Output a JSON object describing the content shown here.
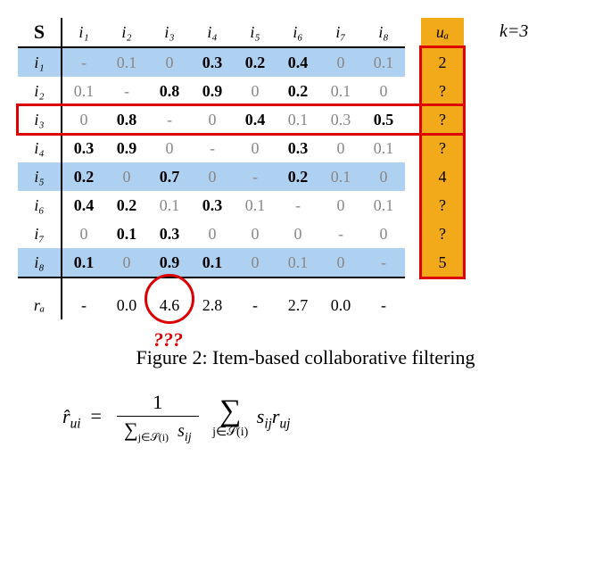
{
  "parameter_k": "k=3",
  "matrix_label": "S",
  "col_headers": [
    "i₁",
    "i₂",
    "i₃",
    "i₄",
    "i₅",
    "i₆",
    "i₇",
    "i₈"
  ],
  "row_headers": [
    "i₁",
    "i₂",
    "i₃",
    "i₄",
    "i₅",
    "i₆",
    "i₇",
    "i₈"
  ],
  "ua_header": "uₐ",
  "ra_header": "rₐ",
  "similarity": [
    [
      "-",
      "0.1",
      "0",
      "0.3",
      "0.2",
      "0.4",
      "0",
      "0.1"
    ],
    [
      "0.1",
      "-",
      "0.8",
      "0.9",
      "0",
      "0.2",
      "0.1",
      "0"
    ],
    [
      "0",
      "0.8",
      "-",
      "0",
      "0.4",
      "0.1",
      "0.3",
      "0.5"
    ],
    [
      "0.3",
      "0.9",
      "0",
      "-",
      "0",
      "0.3",
      "0",
      "0.1"
    ],
    [
      "0.2",
      "0",
      "0.7",
      "0",
      "-",
      "0.2",
      "0.1",
      "0"
    ],
    [
      "0.4",
      "0.2",
      "0.1",
      "0.3",
      "0.1",
      "-",
      "0",
      "0.1"
    ],
    [
      "0",
      "0.1",
      "0.3",
      "0",
      "0",
      "0",
      "-",
      "0"
    ],
    [
      "0.1",
      "0",
      "0.9",
      "0.1",
      "0",
      "0.1",
      "0",
      "-"
    ]
  ],
  "bold_mask": [
    [
      0,
      0,
      0,
      1,
      1,
      1,
      0,
      0
    ],
    [
      0,
      0,
      1,
      1,
      0,
      1,
      0,
      0
    ],
    [
      0,
      1,
      0,
      0,
      1,
      0,
      0,
      1
    ],
    [
      1,
      1,
      0,
      0,
      0,
      1,
      0,
      0
    ],
    [
      1,
      0,
      1,
      0,
      0,
      1,
      0,
      0
    ],
    [
      1,
      1,
      0,
      1,
      0,
      0,
      0,
      0
    ],
    [
      0,
      1,
      1,
      0,
      0,
      0,
      0,
      0
    ],
    [
      1,
      0,
      1,
      1,
      0,
      0,
      0,
      0
    ]
  ],
  "row_blue_mask": [
    1,
    0,
    0,
    0,
    1,
    0,
    0,
    1
  ],
  "ua": [
    "2",
    "?",
    "?",
    "?",
    "4",
    "?",
    "?",
    "5"
  ],
  "ra": [
    "-",
    "0.0",
    "4.6",
    "2.8",
    "-",
    "2.7",
    "0.0",
    "-"
  ],
  "circled_index": 2,
  "question_marks": "???",
  "caption": "Figure 2: Item-based collaborative filtering",
  "formula": {
    "lhs": "r̂",
    "lhs_sub": "ui",
    "denom_sum_sub": "j∈𝒮(i)",
    "denom_term": "s",
    "denom_term_sub": "ij",
    "outer_sum_sub": "j∈𝒮(i)",
    "rhs_term1": "s",
    "rhs_term1_sub": "ij",
    "rhs_term2": "r",
    "rhs_term2_sub": "uj"
  },
  "chart_data": {
    "type": "table",
    "title": "Item-item similarity matrix with user ratings",
    "items": [
      "i1",
      "i2",
      "i3",
      "i4",
      "i5",
      "i6",
      "i7",
      "i8"
    ],
    "S": [
      [
        null,
        0.1,
        0,
        0.3,
        0.2,
        0.4,
        0,
        0.1
      ],
      [
        0.1,
        null,
        0.8,
        0.9,
        0,
        0.2,
        0.1,
        0
      ],
      [
        0,
        0.8,
        null,
        0,
        0.4,
        0.1,
        0.3,
        0.5
      ],
      [
        0.3,
        0.9,
        0,
        null,
        0,
        0.3,
        0,
        0.1
      ],
      [
        0.2,
        0,
        0.7,
        0,
        null,
        0.2,
        0.1,
        0
      ],
      [
        0.4,
        0.2,
        0.1,
        0.3,
        0.1,
        null,
        0,
        0.1
      ],
      [
        0,
        0.1,
        0.3,
        0,
        0,
        0,
        null,
        0
      ],
      [
        0.1,
        0,
        0.9,
        0.1,
        0,
        0.1,
        0,
        null
      ]
    ],
    "ua": [
      2,
      null,
      null,
      null,
      4,
      null,
      null,
      5
    ],
    "ra": [
      null,
      0.0,
      4.6,
      2.8,
      null,
      2.7,
      0.0,
      null
    ],
    "k": 3,
    "highlighted_row_for_neighbors": "i3",
    "selected_neighbor_rows": [
      "i1",
      "i5",
      "i8"
    ]
  }
}
